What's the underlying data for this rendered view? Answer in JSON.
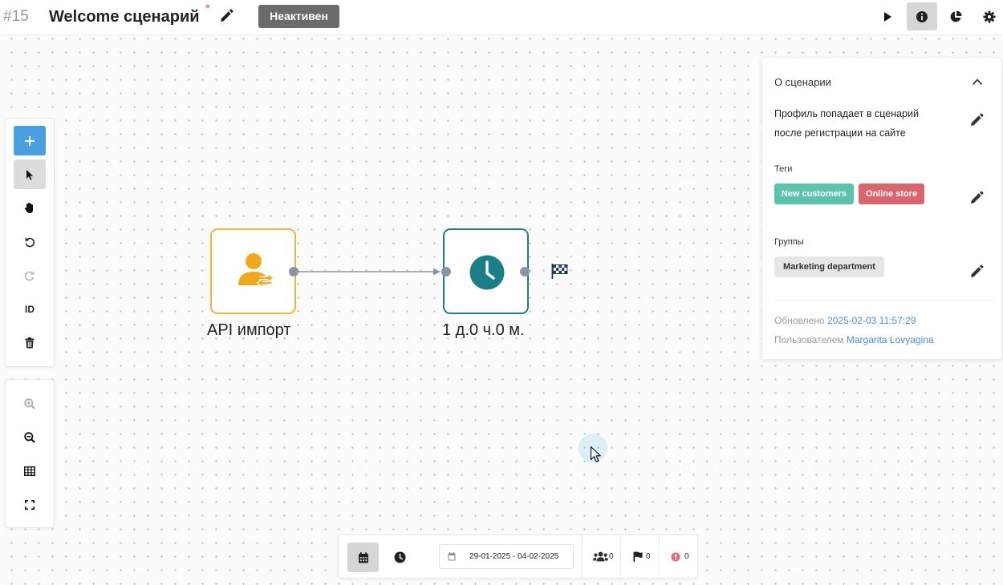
{
  "header": {
    "id": "#15",
    "title": "Welcome сценарий",
    "unsaved_mark": "*",
    "status": "Неактивен",
    "icons": [
      "pencil-icon",
      "play-icon",
      "info-icon",
      "pie-chart-icon",
      "gear-icon"
    ]
  },
  "toolbar": {
    "tools": [
      "plus-icon",
      "pointer-icon",
      "hand-icon",
      "undo-icon",
      "redo-icon",
      "ID",
      "trash-icon"
    ],
    "id_label": "ID",
    "view_tools": [
      "zoom-in-icon",
      "zoom-out-icon",
      "grid-icon",
      "fullscreen-icon"
    ]
  },
  "nodes": [
    {
      "label": "API импорт",
      "icon": "user-exchange-icon",
      "color": "#f0b43c"
    },
    {
      "label": "1 д.0 ч.0 м.",
      "icon": "clock-icon",
      "color": "#1c7f87"
    }
  ],
  "end_marker": "checkered-flag-icon",
  "panel": {
    "title": "О сценарии",
    "description_lines": [
      "Профиль попадает в сценарий",
      "после регистрации на сайте"
    ],
    "tags_label": "Теги",
    "tags": [
      {
        "name": "New customers",
        "color": "#5cc4ac"
      },
      {
        "name": "Online store",
        "color": "#d9666e"
      }
    ],
    "groups_label": "Группы",
    "groups": [
      "Marketing department"
    ],
    "updated_label": "Обновлено",
    "updated_value": "2025-02-03 11:57:29",
    "user_label": "Пользователем",
    "user_value": "Margarita Lovyagina"
  },
  "bottombar": {
    "date_range": "29-01-2025 - 04-02-2025",
    "stats": [
      {
        "icon": "users-icon",
        "value": "0"
      },
      {
        "icon": "flag-icon",
        "value": "0"
      },
      {
        "icon": "error-icon",
        "value": "0"
      }
    ]
  },
  "colors": {
    "accent": "#4a9fe0",
    "status_badge": "#6b6b6b",
    "link": "#4a90d9"
  }
}
